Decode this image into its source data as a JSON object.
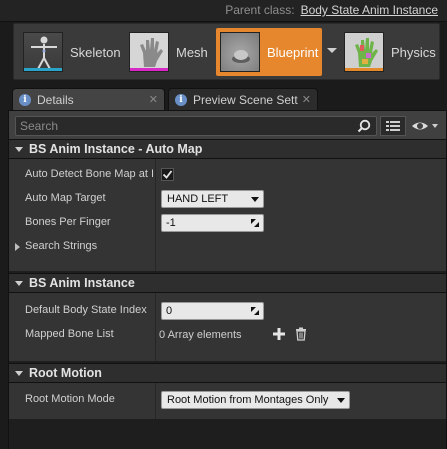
{
  "header": {
    "parent_class_label": "Parent class:",
    "parent_class_value": "Body State Anim Instance"
  },
  "modes": [
    {
      "label": "Skeleton",
      "icon": "skeleton-icon",
      "bar_color": "#2aa3c9"
    },
    {
      "label": "Mesh",
      "icon": "hand-mesh-icon",
      "bar_color": "#d829c6"
    },
    {
      "label": "Blueprint",
      "icon": "blueprint-icon",
      "bar_color": "#e6862d",
      "active": true
    },
    {
      "label": "Physics",
      "icon": "physics-hand-icon",
      "bar_color": "#e28a2c"
    }
  ],
  "tabs": [
    {
      "label": "Details",
      "icon": "info-icon"
    },
    {
      "label": "Preview Scene Sett",
      "icon": "info-icon"
    }
  ],
  "search": {
    "placeholder": "Search"
  },
  "categories": [
    {
      "title": "BS Anim Instance - Auto Map",
      "rows": {
        "auto_detect": {
          "label": "Auto Detect Bone Map at I",
          "checked": true
        },
        "auto_map_target": {
          "label": "Auto Map Target",
          "value": "HAND LEFT"
        },
        "bones_per_finger": {
          "label": "Bones Per Finger",
          "value": "-1"
        },
        "search_strings": {
          "label": "Search Strings"
        }
      }
    },
    {
      "title": "BS Anim Instance",
      "rows": {
        "default_body_state_index": {
          "label": "Default Body State Index",
          "value": "0"
        },
        "mapped_bone_list": {
          "label": "Mapped Bone List",
          "value": "0 Array elements"
        }
      }
    },
    {
      "title": "Root Motion",
      "rows": {
        "root_motion_mode": {
          "label": "Root Motion Mode",
          "value": "Root Motion from Montages Only"
        }
      }
    }
  ],
  "colors": {
    "accent": "#e6862d",
    "panel_bg": "#404040"
  }
}
